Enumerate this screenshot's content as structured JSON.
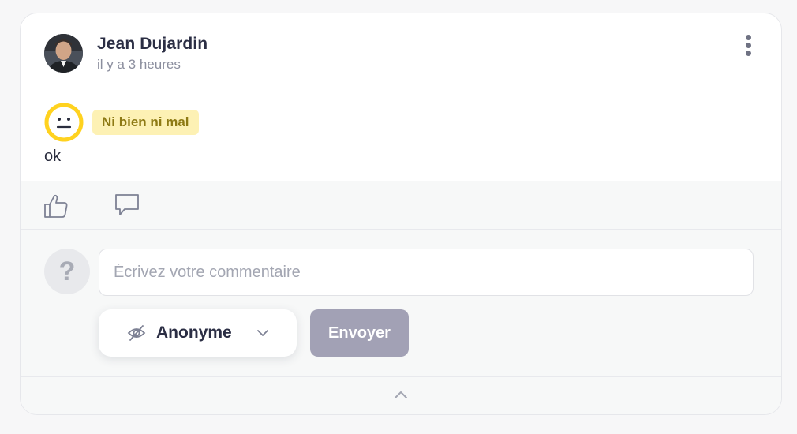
{
  "post": {
    "author": "Jean Dujardin",
    "timestamp": "il y a 3 heures",
    "mood_label": "Ni bien ni mal",
    "text": "ok"
  },
  "icons": {
    "more": "more-vertical-icon",
    "like": "thumbs-up-icon",
    "comment": "comment-bubble-icon",
    "anonymous": "eye-off-icon",
    "dropdown": "chevron-down-icon",
    "collapse": "chevron-up-icon",
    "mood": "neutral-face-icon"
  },
  "comment_form": {
    "placeholder": "Écrivez votre commentaire",
    "value": "",
    "anonymous_avatar": "?",
    "identity_selected": "Anonyme",
    "send_label": "Envoyer"
  },
  "colors": {
    "mood_ring": "#ffd21f",
    "mood_badge_bg": "#fdf1b4",
    "mood_badge_text": "#8e7a14",
    "send_button": "#a2a1b5",
    "icon_gray": "#7d8194"
  }
}
